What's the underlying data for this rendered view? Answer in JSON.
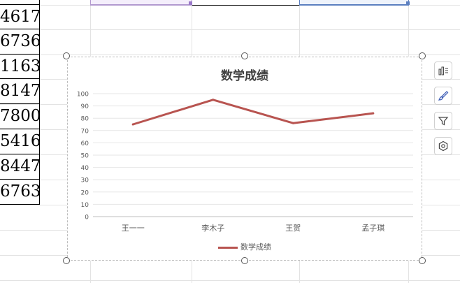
{
  "sheet": {
    "numbers": [
      "4617",
      "6736",
      "1163",
      "8147",
      "7800",
      "5416",
      "8447",
      "6763"
    ]
  },
  "chart_data": {
    "type": "line",
    "title": "数学成绩",
    "categories": [
      "王一一",
      "李木子",
      "王贺",
      "孟子琪"
    ],
    "series": [
      {
        "name": "数学成绩",
        "values": [
          75,
          95,
          76,
          84
        ],
        "color": "#b85450"
      }
    ],
    "ylim": [
      0,
      100
    ],
    "yticks": [
      0,
      10,
      20,
      30,
      40,
      50,
      60,
      70,
      80,
      90,
      100
    ],
    "grid": true,
    "legend": "bottom"
  },
  "side_toolbar": {
    "icons": [
      "chart-elements-icon",
      "chart-style-icon",
      "chart-filter-icon",
      "chart-settings-icon"
    ]
  }
}
